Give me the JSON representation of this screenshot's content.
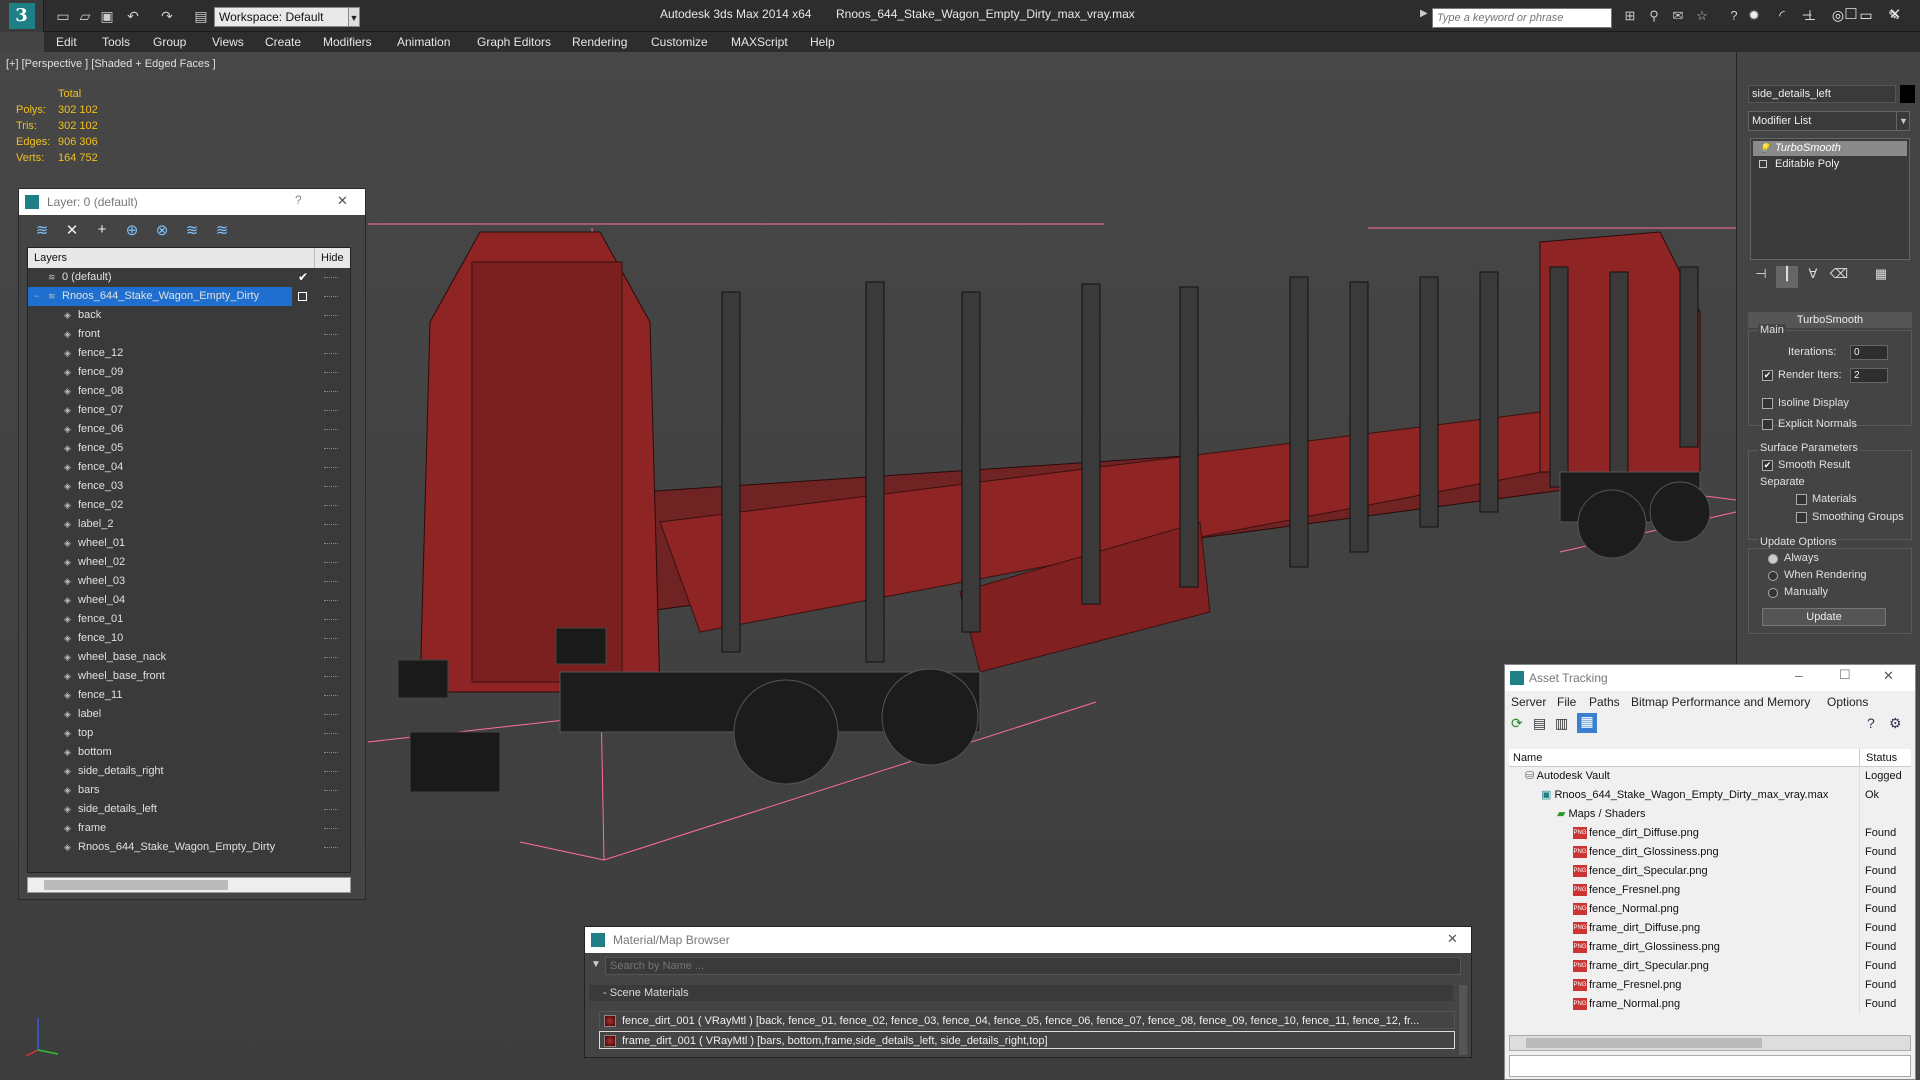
{
  "titlebar": {
    "workspace": "Workspace: Default",
    "app_title": "Autodesk 3ds Max  2014 x64",
    "file_title": "Rnoos_644_Stake_Wagon_Empty_Dirty_max_vray.max",
    "search_placeholder": "Type a keyword or phrase"
  },
  "menu": [
    "Edit",
    "Tools",
    "Group",
    "Views",
    "Create",
    "Modifiers",
    "Animation",
    "Graph Editors",
    "Rendering",
    "Customize",
    "MAXScript",
    "Help"
  ],
  "viewport": {
    "label": "[+] [Perspective ] [Shaded + Edged Faces ]",
    "stats": {
      "header": "Total",
      "polys_label": "Polys:",
      "polys": "302 102",
      "tris_label": "Tris:",
      "tris": "302 102",
      "edges_label": "Edges:",
      "edges": "906 306",
      "verts_label": "Verts:",
      "verts": "164 752"
    }
  },
  "layer_panel": {
    "title": "Layer: 0 (default)",
    "help": "?",
    "close": "✕",
    "col_layers": "Layers",
    "col_hide": "Hide",
    "rows": [
      "0 (default)",
      "Rnoos_644_Stake_Wagon_Empty_Dirty",
      "back",
      "front",
      "fence_12",
      "fence_09",
      "fence_08",
      "fence_07",
      "fence_06",
      "fence_05",
      "fence_04",
      "fence_03",
      "fence_02",
      "label_2",
      "wheel_01",
      "wheel_02",
      "wheel_03",
      "wheel_04",
      "fence_01",
      "fence_10",
      "wheel_base_nack",
      "wheel_base_front",
      "fence_11",
      "label",
      "top",
      "bottom",
      "side_details_right",
      "bars",
      "side_details_left",
      "frame",
      "Rnoos_644_Stake_Wagon_Empty_Dirty"
    ]
  },
  "command_panel": {
    "object_name": "side_details_left",
    "modifier_list": "Modifier List",
    "stack": [
      "TurboSmooth",
      "Editable Poly"
    ],
    "rollout_title": "TurboSmooth",
    "main": "Main",
    "iterations_label": "Iterations:",
    "iterations": "0",
    "render_iters_label": "Render Iters:",
    "render_iters": "2",
    "isoline": "Isoline Display",
    "explicit_normals": "Explicit Normals",
    "surface_params": "Surface Parameters",
    "smooth_result": "Smooth Result",
    "separate": "Separate",
    "materials": "Materials",
    "smoothing_groups": "Smoothing Groups",
    "update_options": "Update Options",
    "always": "Always",
    "when_rendering": "When Rendering",
    "manually": "Manually",
    "update": "Update"
  },
  "asset_tracking": {
    "title": "Asset Tracking",
    "menu": [
      "Server",
      "File",
      "Paths",
      "Bitmap Performance and Memory",
      "Options"
    ],
    "col_name": "Name",
    "col_status": "Status",
    "rows": [
      {
        "name": "Autodesk Vault",
        "status": "Logged",
        "indent": 1,
        "kind": "vault"
      },
      {
        "name": "Rnoos_644_Stake_Wagon_Empty_Dirty_max_vray.max",
        "status": "Ok",
        "indent": 2,
        "kind": "max"
      },
      {
        "name": "Maps / Shaders",
        "status": "",
        "indent": 3,
        "kind": "folder"
      },
      {
        "name": "fence_dirt_Diffuse.png",
        "status": "Found",
        "indent": 4,
        "kind": "png"
      },
      {
        "name": "fence_dirt_Glossiness.png",
        "status": "Found",
        "indent": 4,
        "kind": "png"
      },
      {
        "name": "fence_dirt_Specular.png",
        "status": "Found",
        "indent": 4,
        "kind": "png"
      },
      {
        "name": "fence_Fresnel.png",
        "status": "Found",
        "indent": 4,
        "kind": "png"
      },
      {
        "name": "fence_Normal.png",
        "status": "Found",
        "indent": 4,
        "kind": "png"
      },
      {
        "name": "frame_dirt_Diffuse.png",
        "status": "Found",
        "indent": 4,
        "kind": "png"
      },
      {
        "name": "frame_dirt_Glossiness.png",
        "status": "Found",
        "indent": 4,
        "kind": "png"
      },
      {
        "name": "frame_dirt_Specular.png",
        "status": "Found",
        "indent": 4,
        "kind": "png"
      },
      {
        "name": "frame_Fresnel.png",
        "status": "Found",
        "indent": 4,
        "kind": "png"
      },
      {
        "name": "frame_Normal.png",
        "status": "Found",
        "indent": 4,
        "kind": "png"
      }
    ]
  },
  "material_browser": {
    "title": "Material/Map Browser",
    "search_placeholder": "Search by Name ...",
    "category": "- Scene Materials",
    "rows": [
      "fence_dirt_001  ( VRayMtl )  [back, fence_01, fence_02, fence_03, fence_04, fence_05, fence_06, fence_07, fence_08, fence_09, fence_10, fence_11, fence_12, fr...",
      "frame_dirt_001 ( VRayMtl ) [bars, bottom,frame,side_details_left, side_details_right,top]"
    ]
  },
  "colors": {
    "accent": "#1e6fd0",
    "selection_wire": "#ff6e9a",
    "wagon_red": "#8e2424",
    "stat_yellow": "#f0c020"
  }
}
